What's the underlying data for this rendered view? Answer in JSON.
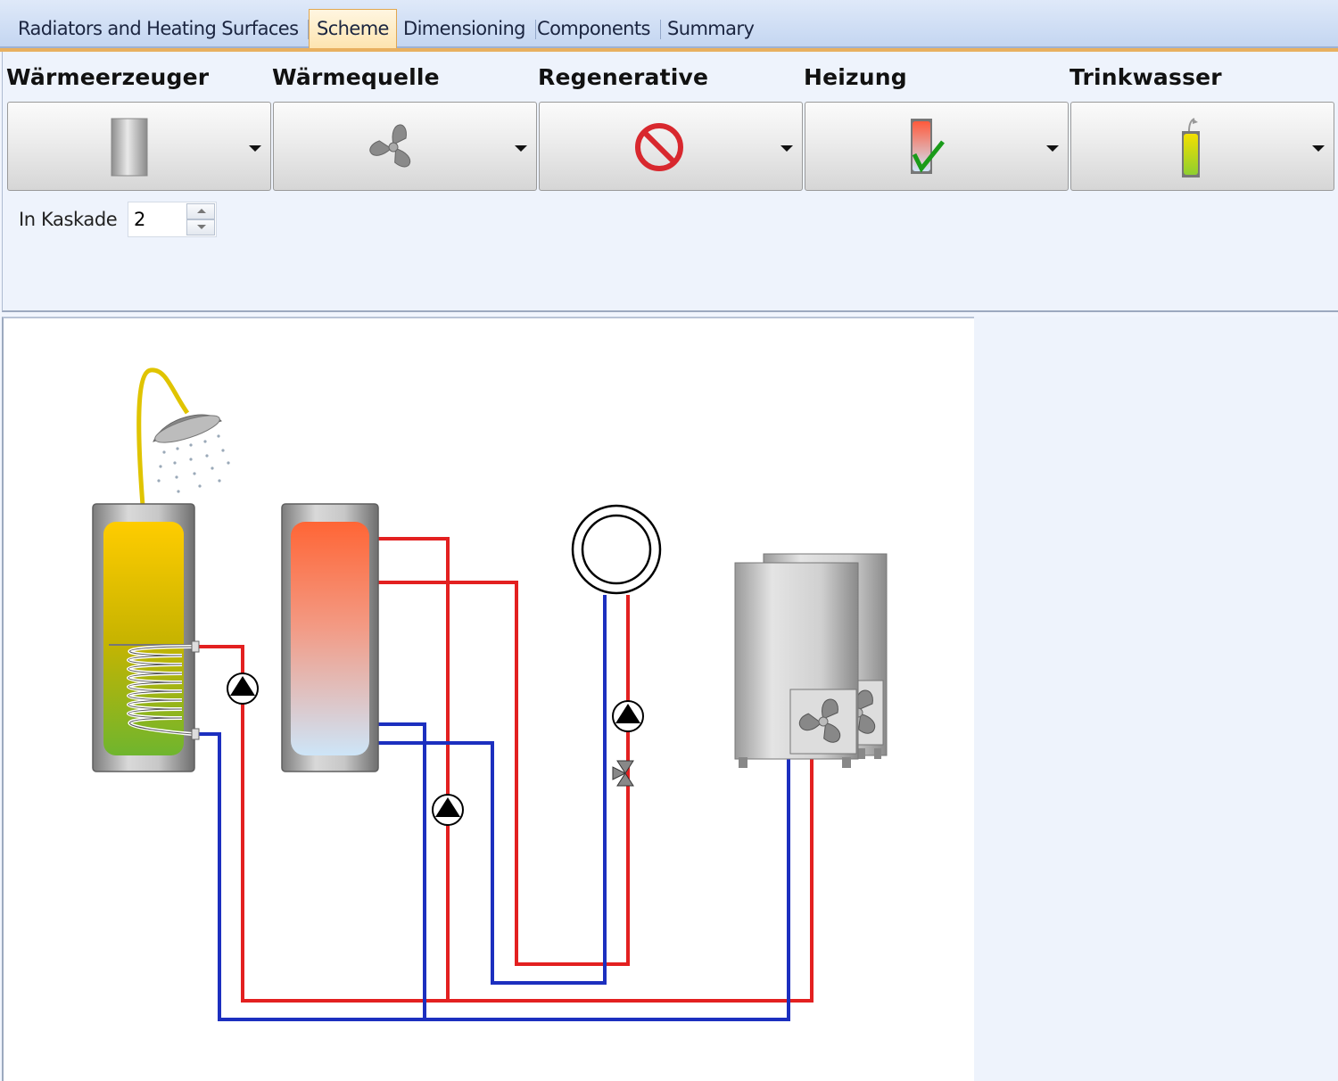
{
  "tabs": [
    {
      "label": "Radiators and Heating Surfaces"
    },
    {
      "label": "Scheme"
    },
    {
      "label": "Dimensioning"
    },
    {
      "label": "Components"
    },
    {
      "label": "Summary"
    }
  ],
  "active_tab": "Scheme",
  "categories": [
    {
      "title": "Wärmeerzeuger",
      "icon": "cylinder-icon"
    },
    {
      "title": "Wärmequelle",
      "icon": "fan-icon"
    },
    {
      "title": "Regenerative",
      "icon": "no-entry-icon"
    },
    {
      "title": "Heizung",
      "icon": "heating-tank-check-icon"
    },
    {
      "title": "Trinkwasser",
      "icon": "water-tank-icon"
    }
  ],
  "kaskade": {
    "label": "In Kaskade",
    "value": "2"
  },
  "colors": {
    "flow": "#e32020",
    "return": "#1c2fbf",
    "tab_active": "#fde4b0"
  }
}
